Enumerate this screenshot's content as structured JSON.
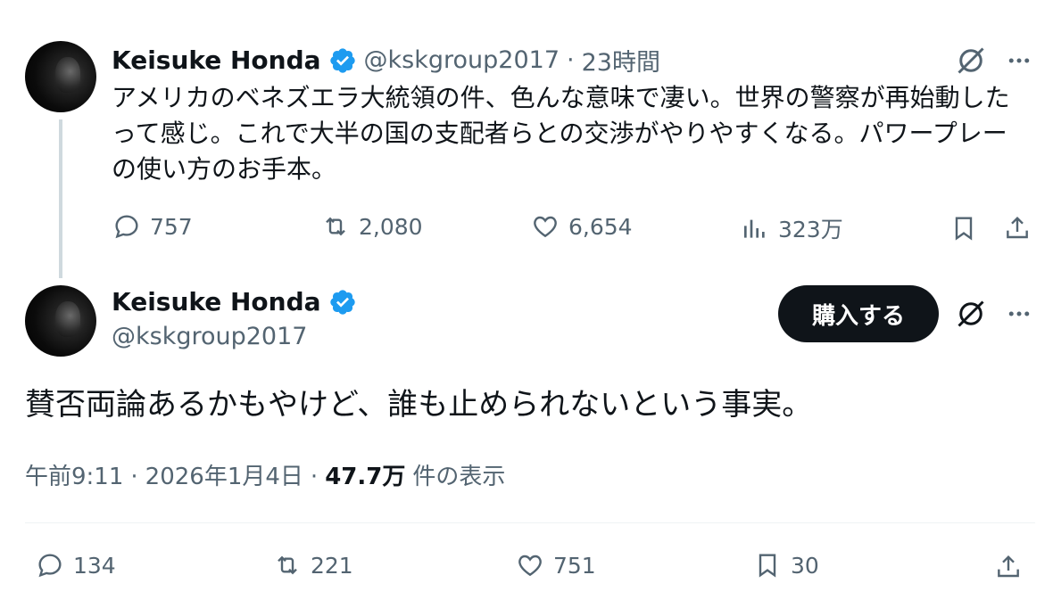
{
  "thread_tweet": {
    "name": "Keisuke Honda",
    "handle": "@kskgroup2017",
    "separator": "·",
    "time": "23時間",
    "text": "アメリカのベネズエラ大統領の件、色んな意味で凄い。世界の警察が再始動したって感じ。これで大半の国の支配者らとの交渉がやりやすくなる。パワープレーの使い方のお手本。",
    "replies": "757",
    "reposts": "2,080",
    "likes": "6,654",
    "views": "323万"
  },
  "main_tweet": {
    "name": "Keisuke Honda",
    "handle": "@kskgroup2017",
    "buy_label": "購入する",
    "text": "賛否両論あるかもやけど、誰も止められないという事実。",
    "time": "午前9:11",
    "sep1": "·",
    "date": "2026年1月4日",
    "sep2": "·",
    "views_count": "47.7万",
    "views_label": "件の表示",
    "replies": "134",
    "reposts": "221",
    "likes": "751",
    "bookmarks": "30"
  },
  "colors": {
    "text": "#0f1419",
    "secondary": "#536471",
    "verified": "#1d9bf0",
    "thread_line": "#cfd9de",
    "divider": "#eff3f4"
  }
}
